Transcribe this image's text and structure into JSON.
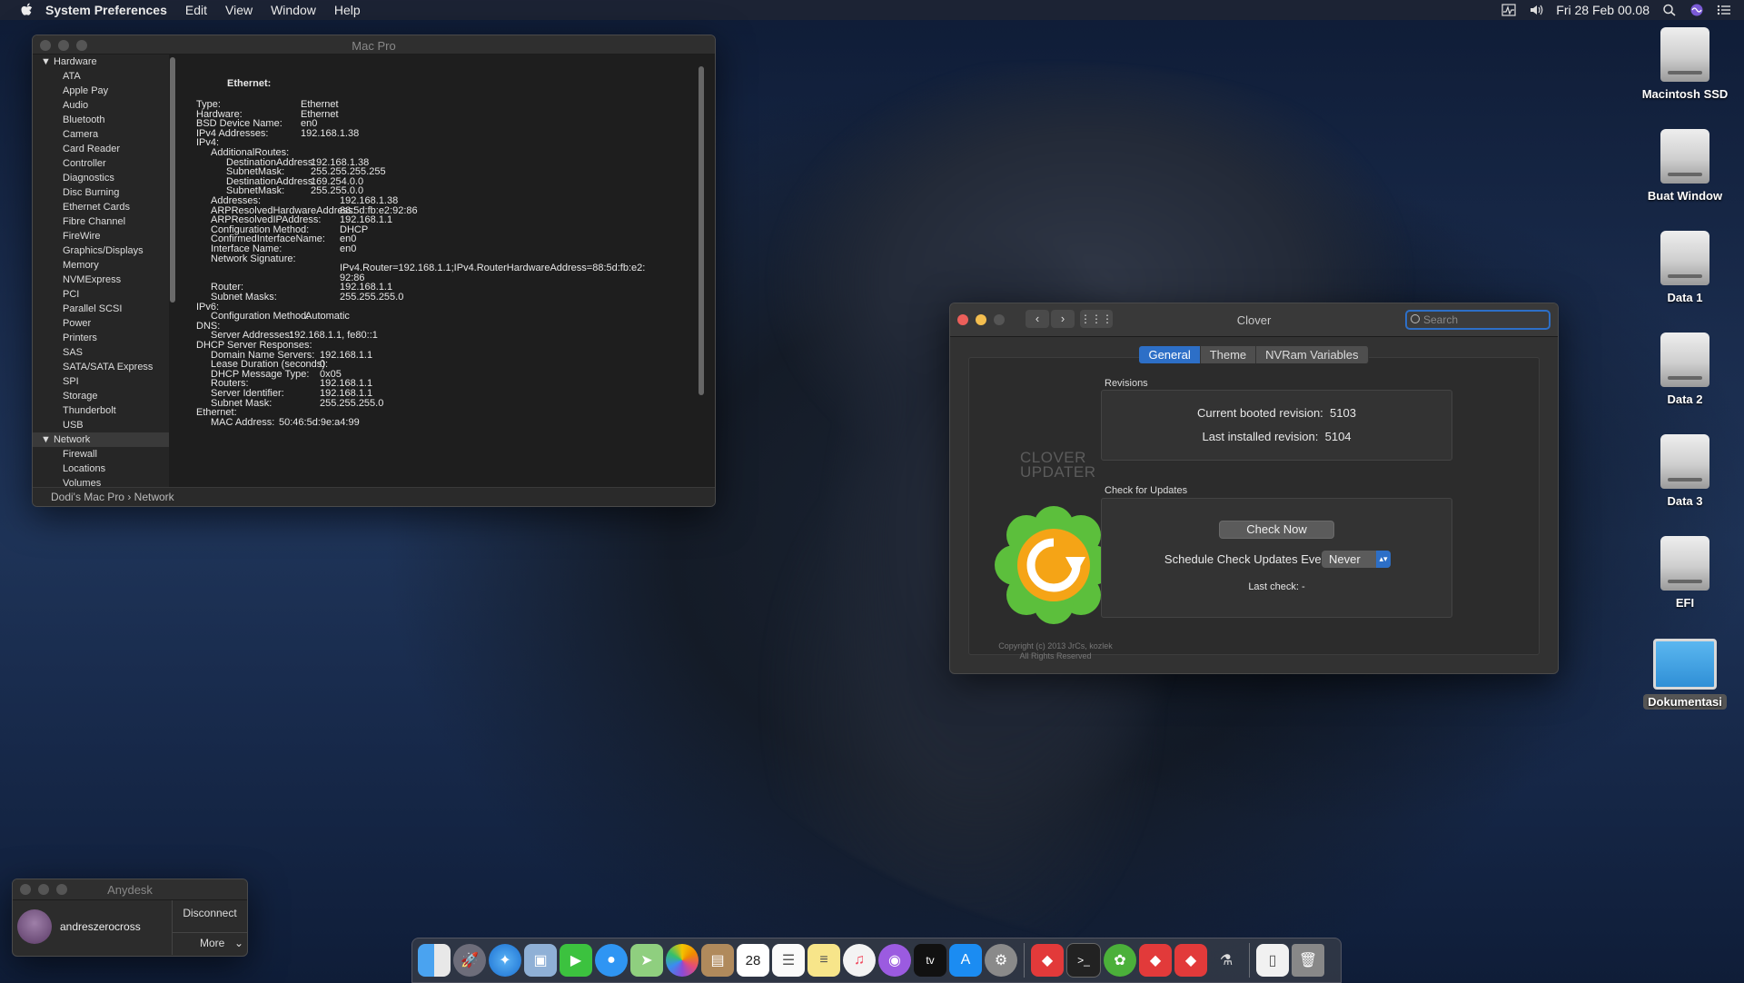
{
  "menubar": {
    "app_name": "System Preferences",
    "items": [
      "Edit",
      "View",
      "Window",
      "Help"
    ],
    "datetime": "Fri 28 Feb  00.08"
  },
  "sysinfo": {
    "title": "Mac Pro",
    "sidebar_hardware_label": "Hardware",
    "hardware_items": [
      "ATA",
      "Apple Pay",
      "Audio",
      "Bluetooth",
      "Camera",
      "Card Reader",
      "Controller",
      "Diagnostics",
      "Disc Burning",
      "Ethernet Cards",
      "Fibre Channel",
      "FireWire",
      "Graphics/Displays",
      "Memory",
      "NVMExpress",
      "PCI",
      "Parallel SCSI",
      "Power",
      "Printers",
      "SAS",
      "SATA/SATA Express",
      "SPI",
      "Storage",
      "Thunderbolt",
      "USB"
    ],
    "sidebar_network_label": "Network",
    "network_items": [
      "Firewall",
      "Locations",
      "Volumes"
    ],
    "heading": "Ethernet:",
    "rows": [
      {
        "k": "Type:",
        "v": "Ethernet"
      },
      {
        "k": "Hardware:",
        "v": "Ethernet"
      },
      {
        "k": "BSD Device Name:",
        "v": "en0"
      },
      {
        "k": "IPv4 Addresses:",
        "v": "192.168.1.38"
      },
      {
        "k": "IPv4:",
        "v": ""
      },
      {
        "k": "AdditionalRoutes:",
        "v": ""
      },
      {
        "k": "DestinationAddress:",
        "v": "192.168.1.38"
      },
      {
        "k": "SubnetMask:",
        "v": "255.255.255.255"
      },
      {
        "k": "DestinationAddress:",
        "v": "169.254.0.0"
      },
      {
        "k": "SubnetMask:",
        "v": "255.255.0.0"
      },
      {
        "k": "Addresses:",
        "v": "192.168.1.38"
      },
      {
        "k": "ARPResolvedHardwareAddress:",
        "v": "88:5d:fb:e2:92:86"
      },
      {
        "k": "ARPResolvedIPAddress:",
        "v": "192.168.1.1"
      },
      {
        "k": "Configuration Method:",
        "v": "DHCP"
      },
      {
        "k": "ConfirmedInterfaceName:",
        "v": "en0"
      },
      {
        "k": "Interface Name:",
        "v": "en0"
      },
      {
        "k": "Network Signature:",
        "v": ""
      },
      {
        "k": "",
        "v": "IPv4.Router=192.168.1.1;IPv4.RouterHardwareAddress=88:5d:fb:e2:"
      },
      {
        "k": "",
        "v": "92:86"
      },
      {
        "k": "Router:",
        "v": "192.168.1.1"
      },
      {
        "k": "Subnet Masks:",
        "v": "255.255.255.0"
      },
      {
        "k": "IPv6:",
        "v": ""
      },
      {
        "k": "Configuration Method:",
        "v": "Automatic"
      },
      {
        "k": "DNS:",
        "v": ""
      },
      {
        "k": "Server Addresses:",
        "v": "192.168.1.1, fe80::1"
      },
      {
        "k": "DHCP Server Responses:",
        "v": ""
      },
      {
        "k": "Domain Name Servers:",
        "v": "192.168.1.1"
      },
      {
        "k": "Lease Duration (seconds):",
        "v": "0"
      },
      {
        "k": "DHCP Message Type:",
        "v": "0x05"
      },
      {
        "k": "Routers:",
        "v": "192.168.1.1"
      },
      {
        "k": "Server Identifier:",
        "v": "192.168.1.1"
      },
      {
        "k": "Subnet Mask:",
        "v": "255.255.255.0"
      },
      {
        "k": "Ethernet:",
        "v": ""
      },
      {
        "k": "MAC Address:",
        "v": "50:46:5d:9e:a4:99"
      }
    ],
    "breadcrumb": "Dodi's Mac Pro › Network"
  },
  "clover": {
    "title": "Clover",
    "search_placeholder": "Search",
    "tabs": [
      "General",
      "Theme",
      "NVRam Variables"
    ],
    "logo_line1": "CLOVER",
    "logo_line2": "UPDATER",
    "copyright_line1": "Copyright (c) 2013 JrCs, kozlek",
    "copyright_line2": "All Rights Reserved",
    "revisions_label": "Revisions",
    "current_rev_label": "Current booted revision:",
    "current_rev": "5103",
    "installed_rev_label": "Last installed revision:",
    "installed_rev": "5104",
    "updates_label": "Check for Updates",
    "check_now": "Check Now",
    "schedule_label": "Schedule Check Updates Every:",
    "schedule_value": "Never",
    "last_check": "Last check: -"
  },
  "anydesk": {
    "title": "Anydesk",
    "user": "andreszerocross",
    "disconnect": "Disconnect",
    "more": "More"
  },
  "desktop_icons": [
    "Macintosh SSD",
    "Buat Window",
    "Data 1",
    "Data 2",
    "Data 3",
    "EFI",
    "Dokumentasi"
  ],
  "dock_calendar_day": "28",
  "dock_tv_label": "tv",
  "colors": {
    "accent": "#2d6fc7",
    "close": "#ec5f5a",
    "minimize": "#f4be4f"
  }
}
